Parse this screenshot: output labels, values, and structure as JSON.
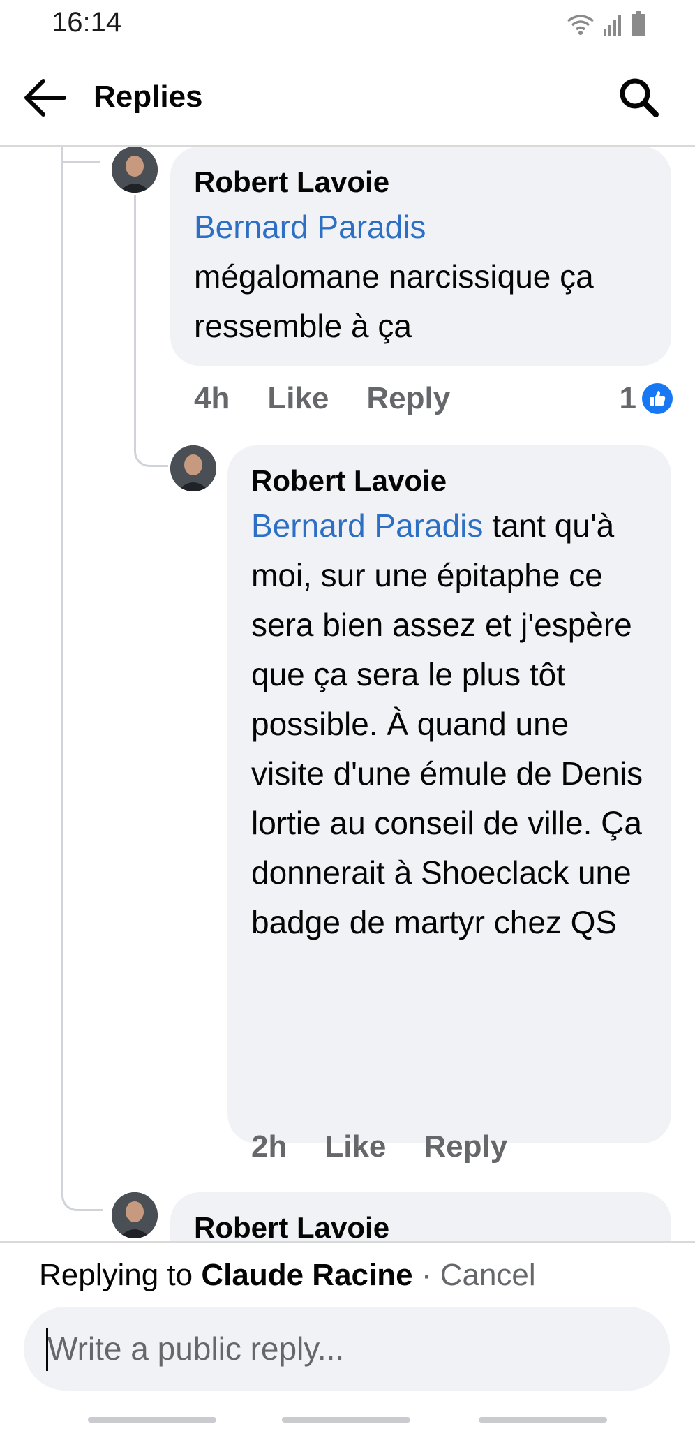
{
  "status_bar": {
    "time": "16:14",
    "icons": [
      "wifi-icon",
      "signal-icon",
      "battery-icon"
    ]
  },
  "header": {
    "title": "Replies",
    "back_icon": "arrow-left-icon",
    "search_icon": "search-icon"
  },
  "comments": [
    {
      "author": "Robert Lavoie",
      "mention": "Bernard Paradis",
      "text": "mégalomane narcissique ça ressemble à ça",
      "time": "4h",
      "like_label": "Like",
      "reply_label": "Reply",
      "reaction_count": "1"
    },
    {
      "author": "Robert Lavoie",
      "mention": "Bernard Paradis",
      "text": "tant qu'à moi, sur une épitaphe ce sera bien assez et j'espère que ça sera le plus tôt possible. À quand une visite d'une émule de Denis lortie au conseil de ville. Ça donnerait à Shoeclack une badge de martyr chez QS",
      "time": "2h",
      "like_label": "Like",
      "reply_label": "Reply"
    },
    {
      "author": "Robert Lavoie"
    }
  ],
  "reply_bar": {
    "replying_prefix": "Replying to",
    "replying_to": "Claude Racine",
    "separator": "·",
    "cancel_label": "Cancel",
    "placeholder": "Write a public reply..."
  },
  "colors": {
    "mention": "#2c6fc4",
    "bubble": "#f0f2f5",
    "meta": "#65676b",
    "like": "#1877f2"
  }
}
